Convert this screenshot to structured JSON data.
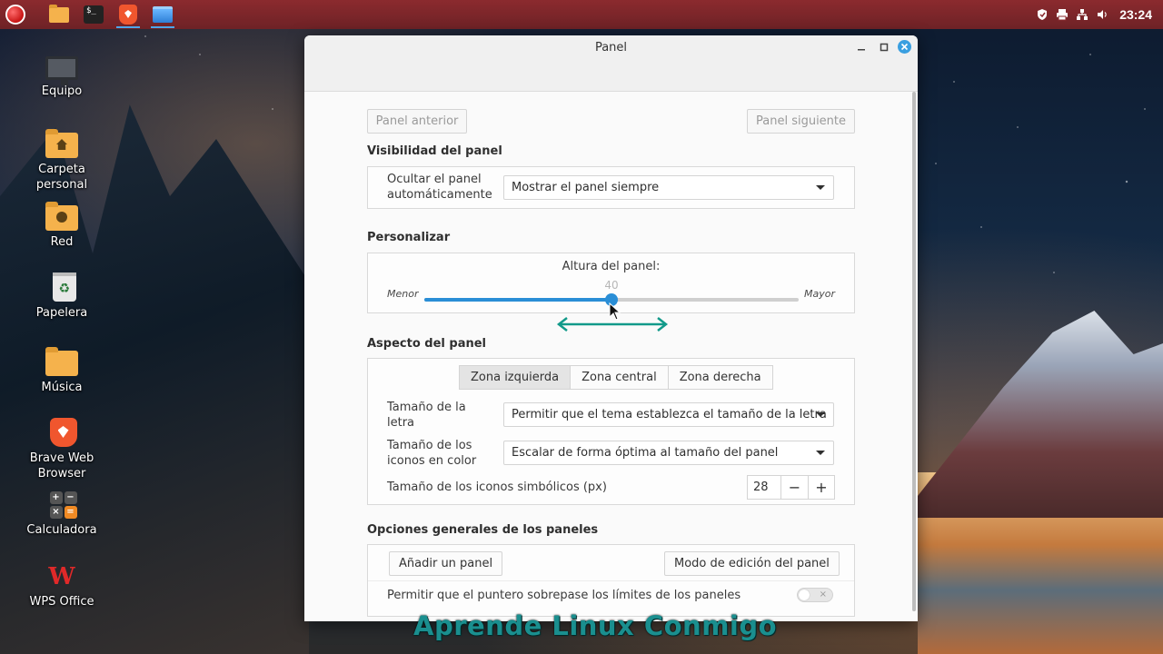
{
  "desktop": {
    "icons": [
      {
        "label": "Equipo"
      },
      {
        "label": "Carpeta\npersonal"
      },
      {
        "label": "Red"
      },
      {
        "label": "Papelera"
      },
      {
        "label": "Música"
      },
      {
        "label": "Brave Web\nBrowser"
      },
      {
        "label": "Calculadora"
      },
      {
        "label": "WPS Office"
      }
    ],
    "watermark": "Aprende Linux Conmigo"
  },
  "taskbar": {
    "clock": "23:24",
    "accent": "#8b2a2e"
  },
  "window": {
    "title": "Panel",
    "nav": {
      "prev": "Panel anterior",
      "next": "Panel siguiente"
    },
    "visibility": {
      "section_title": "Visibilidad del panel",
      "autohide_label": "Ocultar el panel automáticamente",
      "autohide_value": "Mostrar el panel siempre"
    },
    "customize": {
      "section_title": "Personalizar",
      "height_label": "Altura del panel:",
      "min_label": "Menor",
      "max_label": "Mayor",
      "height_value": "40",
      "height_fraction": 0.5
    },
    "appearance": {
      "section_title": "Aspecto del panel",
      "zones": [
        "Zona izquierda",
        "Zona central",
        "Zona derecha"
      ],
      "active_zone": "Zona izquierda",
      "font_size_label": "Tamaño de la letra",
      "font_size_value": "Permitir que el tema establezca el tamaño de la letra",
      "color_icons_label": "Tamaño de los iconos en color",
      "color_icons_value": "Escalar de forma óptima al tamaño del panel",
      "symbolic_icons_label": "Tamaño de los iconos simbólicos (px)",
      "symbolic_icons_value": "28",
      "minus": "−",
      "plus": "+"
    },
    "general": {
      "section_title": "Opciones generales de los paneles",
      "add_panel": "Añadir un panel",
      "edit_mode": "Modo de edición del panel",
      "pointer_overflow_label": "Permitir que el puntero sobrepase los límites de los paneles",
      "pointer_overflow_enabled": false
    },
    "accent_color": "#2a8ed6"
  }
}
